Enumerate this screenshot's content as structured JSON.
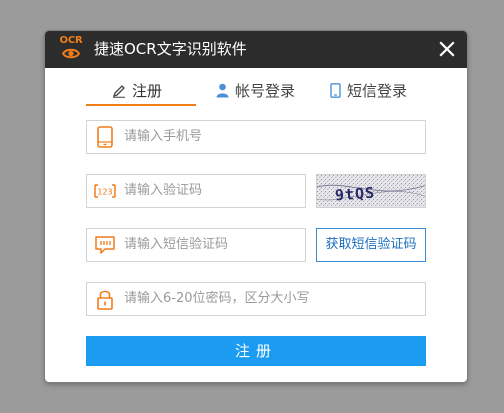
{
  "window": {
    "logo_text": "OCR",
    "title": "捷速OCR文字识别软件"
  },
  "tabs": [
    {
      "label": "注册",
      "icon": "pencil-icon",
      "active": true
    },
    {
      "label": "帐号登录",
      "icon": "user-icon",
      "active": false
    },
    {
      "label": "短信登录",
      "icon": "phone-icon",
      "active": false
    }
  ],
  "form": {
    "phone_placeholder": "请输入手机号",
    "captcha_placeholder": "请输入验证码",
    "captcha_icon_text": "123",
    "captcha_image_text": "9tQS",
    "sms_code_placeholder": "请输入短信验证码",
    "sms_button_label": "获取短信验证码",
    "password_placeholder": "请输入6-20位密码，区分大小写",
    "submit_label": "注册"
  },
  "colors": {
    "accent_orange": "#f07d19",
    "primary_blue": "#1b9cf0",
    "titlebar": "#2c2c2c"
  }
}
